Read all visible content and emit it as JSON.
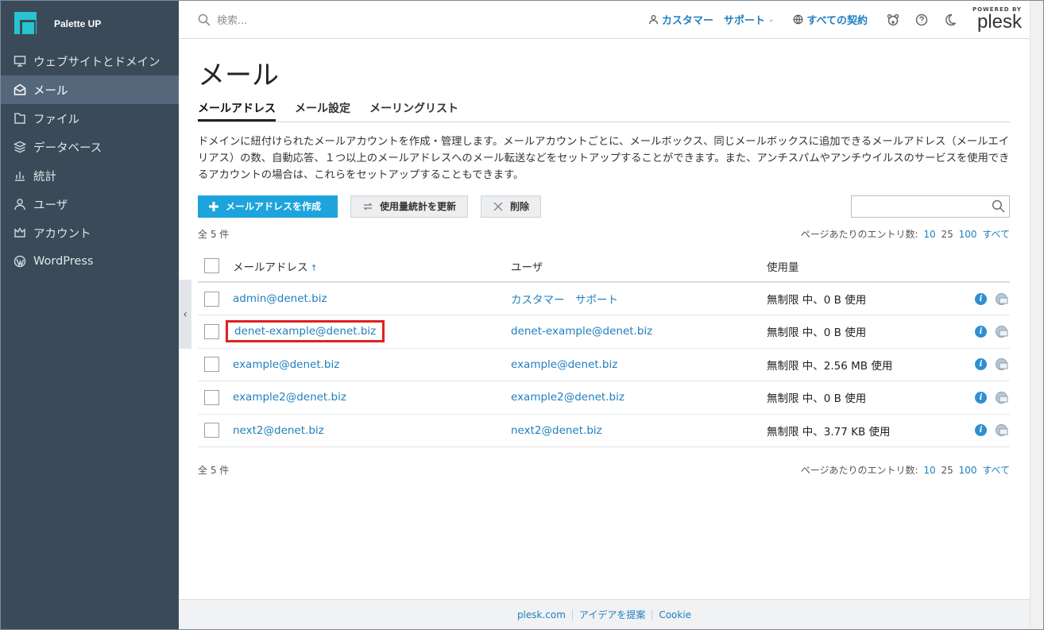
{
  "brand": {
    "name": "Palette UP"
  },
  "sidebar": {
    "items": [
      {
        "label": "ウェブサイトとドメイン",
        "icon": "monitor-icon",
        "active": false
      },
      {
        "label": "メール",
        "icon": "mail-icon",
        "active": true
      },
      {
        "label": "ファイル",
        "icon": "file-icon",
        "active": false
      },
      {
        "label": "データベース",
        "icon": "database-icon",
        "active": false
      },
      {
        "label": "統計",
        "icon": "stats-icon",
        "active": false
      },
      {
        "label": "ユーザ",
        "icon": "user-icon",
        "active": false
      },
      {
        "label": "アカウント",
        "icon": "crown-icon",
        "active": false
      },
      {
        "label": "WordPress",
        "icon": "wordpress-icon",
        "active": false
      }
    ]
  },
  "topbar": {
    "search_placeholder": "検索...",
    "user_label": "カスタマー　サポート",
    "subscriptions_label": "すべての契約",
    "plesk_powered": "POWERED BY",
    "plesk_name": "plesk"
  },
  "page": {
    "title": "メール",
    "tabs": [
      {
        "label": "メールアドレス",
        "active": true
      },
      {
        "label": "メール設定",
        "active": false
      },
      {
        "label": "メーリングリスト",
        "active": false
      }
    ],
    "description": "ドメインに紐付けられたメールアカウントを作成・管理します。メールアカウントごとに、メールボックス、同じメールボックスに追加できるメールアドレス（メールエイリアス）の数、自動応答、１つ以上のメールアドレスへのメール転送などをセットアップすることができます。また、アンチスパムやアンチウイルスのサービスを使用できるアカウントの場合は、これらをセットアップすることもできます。"
  },
  "toolbar": {
    "create_label": "メールアドレスを作成",
    "refresh_label": "使用量統計を更新",
    "delete_label": "削除"
  },
  "list": {
    "total": "全 5 件",
    "per_page_label": "ページあたりのエントリ数:",
    "per_page_options": [
      "10",
      "25",
      "100",
      "すべて"
    ],
    "columns": {
      "email": "メールアドレス",
      "user": "ユーザ",
      "usage": "使用量"
    },
    "rows": [
      {
        "email": "admin@denet.biz",
        "user": "カスタマー　サポート",
        "usage": "無制限 中、0 B 使用",
        "highlighted": false
      },
      {
        "email": "denet-example@denet.biz",
        "user": "denet-example@denet.biz",
        "usage": "無制限 中、0 B 使用",
        "highlighted": true
      },
      {
        "email": "example@denet.biz",
        "user": "example@denet.biz",
        "usage": "無制限 中、2.56 MB 使用",
        "highlighted": false
      },
      {
        "email": "example2@denet.biz",
        "user": "example2@denet.biz",
        "usage": "無制限 中、0 B 使用",
        "highlighted": false
      },
      {
        "email": "next2@denet.biz",
        "user": "next2@denet.biz",
        "usage": "無制限 中、3.77 KB 使用",
        "highlighted": false
      }
    ]
  },
  "footer": {
    "links": [
      "plesk.com",
      "アイデアを提案",
      "Cookie"
    ]
  },
  "colors": {
    "sidebar_bg": "#3a4a58",
    "accent": "#1ea4dc",
    "link": "#1f7fbf",
    "highlight": "#e02020"
  }
}
